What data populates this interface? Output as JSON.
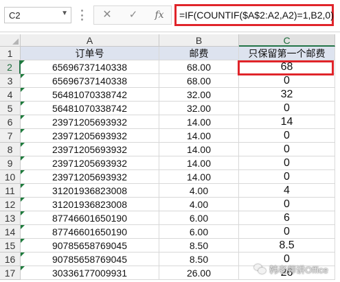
{
  "formula_bar": {
    "name_box": "C2",
    "cancel_symbol": "✕",
    "enter_symbol": "✓",
    "fx_symbol": "fx",
    "formula": "=IF(COUNTIF($A$2:A2,A2)=1,B2,0)"
  },
  "sheet": {
    "columns": [
      "A",
      "B",
      "C"
    ],
    "selected_cell": "C2",
    "rows": [
      {
        "num": "1",
        "a": "订单号",
        "b": "邮费",
        "c": "只保留第一个邮费"
      },
      {
        "num": "2",
        "a": "65696737140338",
        "b": "68.00",
        "c": "68"
      },
      {
        "num": "3",
        "a": "65696737140338",
        "b": "68.00",
        "c": "0"
      },
      {
        "num": "4",
        "a": "56481070338742",
        "b": "32.00",
        "c": "32"
      },
      {
        "num": "5",
        "a": "56481070338742",
        "b": "32.00",
        "c": "0"
      },
      {
        "num": "6",
        "a": "23971205693932",
        "b": "14.00",
        "c": "14"
      },
      {
        "num": "7",
        "a": "23971205693932",
        "b": "14.00",
        "c": "0"
      },
      {
        "num": "8",
        "a": "23971205693932",
        "b": "14.00",
        "c": "0"
      },
      {
        "num": "9",
        "a": "23971205693932",
        "b": "14.00",
        "c": "0"
      },
      {
        "num": "10",
        "a": "23971205693932",
        "b": "14.00",
        "c": "0"
      },
      {
        "num": "11",
        "a": "31201936823008",
        "b": "4.00",
        "c": "4"
      },
      {
        "num": "12",
        "a": "31201936823008",
        "b": "4.00",
        "c": "0"
      },
      {
        "num": "13",
        "a": "87746601650190",
        "b": "6.00",
        "c": "6"
      },
      {
        "num": "14",
        "a": "87746601650190",
        "b": "6.00",
        "c": "0"
      },
      {
        "num": "15",
        "a": "90785658769045",
        "b": "8.50",
        "c": "8.5"
      },
      {
        "num": "16",
        "a": "90785658769045",
        "b": "8.50",
        "c": "0"
      },
      {
        "num": "17",
        "a": "30336177009931",
        "b": "26.00",
        "c": "26"
      }
    ]
  },
  "watermark": {
    "icon": "wechat-icon",
    "text": "韩老师讲Office"
  },
  "colors": {
    "highlight_border": "#e0242a",
    "header_fill": "#dde3ef",
    "excel_green": "#217346"
  }
}
